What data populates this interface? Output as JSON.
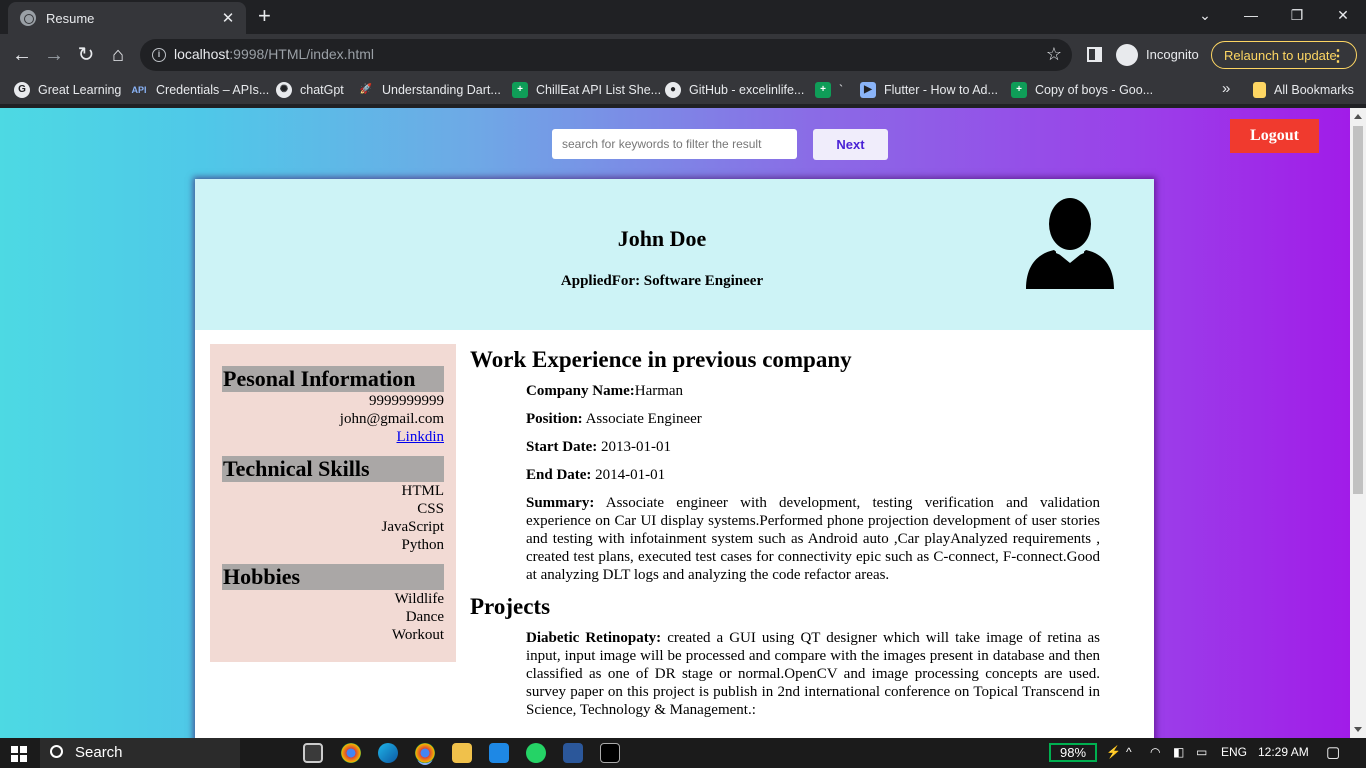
{
  "browser": {
    "tab_title": "Resume",
    "url_host": "localhost",
    "url_path": ":9998/HTML/index.html",
    "incognito_label": "Incognito",
    "relaunch_label": "Relaunch to update",
    "bookmarks": [
      {
        "label": "Great Learning",
        "icon": "google-icon"
      },
      {
        "label": "Credentials – APIs...",
        "icon": "api-icon"
      },
      {
        "label": "chatGpt",
        "icon": "chatgpt-icon"
      },
      {
        "label": "Understanding Dart...",
        "icon": "rocket-icon"
      },
      {
        "label": "ChillEat API List She...",
        "icon": "sheets-icon"
      },
      {
        "label": "GitHub - excelinlife...",
        "icon": "github-icon"
      },
      {
        "label": "`",
        "icon": "sheets-icon"
      },
      {
        "label": "Flutter - How to Ad...",
        "icon": "flutter-icon"
      },
      {
        "label": "Copy of boys - Goo...",
        "icon": "sheets-icon"
      }
    ],
    "all_bookmarks_label": "All Bookmarks",
    "overflow_label": "»"
  },
  "page": {
    "search_placeholder": "search for keywords to filter the result",
    "next_label": "Next",
    "logout_label": "Logout"
  },
  "resume": {
    "name": "John Doe",
    "applied_for": "AppliedFor: Software Engineer",
    "personal": {
      "heading": "Pesonal Information",
      "phone": "9999999999",
      "email": "john@gmail.com",
      "linkedin": "Linkdin"
    },
    "skills": {
      "heading": "Technical Skills",
      "items": [
        "HTML",
        "CSS",
        "JavaScript",
        "Python"
      ]
    },
    "hobbies": {
      "heading": "Hobbies",
      "items": [
        "Wildlife",
        "Dance",
        "Workout"
      ]
    },
    "work": {
      "heading": "Work Experience in previous company",
      "company_label": "Company Name:",
      "company": "Harman",
      "position_label": "Position:",
      "position": " Associate Engineer",
      "start_label": "Start Date:",
      "start": " 2013-01-01",
      "end_label": "End Date:",
      "end": " 2014-01-01",
      "summary_label": "Summary:",
      "summary": " Associate engineer with development, testing verification and validation experience on Car UI display systems.Performed phone projection development of user stories and testing with infotainment system such as Android auto ,Car playAnalyzed requirements , created test plans, executed test cases for connectivity epic such as C-connect, F-connect.Good at analyzing DLT logs and analyzing the code refactor areas."
    },
    "projects": {
      "heading": "Projects",
      "title": "Diabetic Retinopaty:",
      "description": " created a GUI using QT designer which will take image of retina as input, input image will be processed and compare with the images present in database and then classified as one of DR stage or normal.OpenCV and image processing concepts are used. survey paper on this project is publish in 2nd international conference on Topical Transcend in Science, Technology & Management.:"
    }
  },
  "taskbar": {
    "search_label": "Search",
    "battery": "98%",
    "language": "ENG",
    "time": "12:29 AM"
  }
}
